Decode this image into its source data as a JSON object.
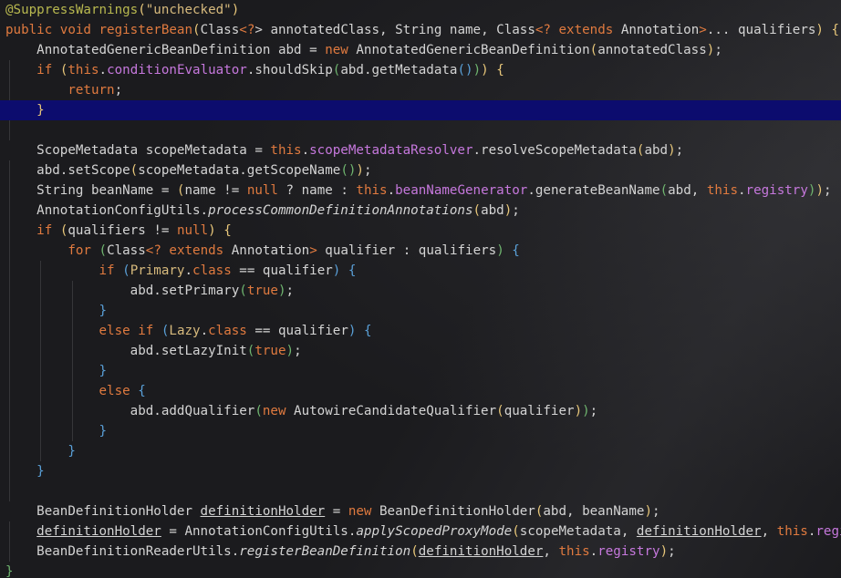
{
  "editor": {
    "language": "java",
    "highlighted_line": 6,
    "colors": {
      "background": "#1b1b1e",
      "line_highlight": "#0c0c6e",
      "keyword": "#e07a3f",
      "field": "#c678dd",
      "annotation": "#b8b84f",
      "string": "#d7ba7d",
      "text": "#d4d4d4"
    },
    "lines": [
      {
        "indent": 0,
        "tokens": [
          {
            "t": "@SuppressWarnings",
            "c": "ann"
          },
          {
            "t": "(",
            "c": "p1"
          },
          {
            "t": "\"unchecked\"",
            "c": "str"
          },
          {
            "t": ")",
            "c": "p1"
          }
        ]
      },
      {
        "indent": 0,
        "tokens": [
          {
            "t": "public",
            "c": "kw"
          },
          {
            "t": " "
          },
          {
            "t": "void",
            "c": "kw"
          },
          {
            "t": " "
          },
          {
            "t": "registerBean",
            "c": "kw"
          },
          {
            "t": "(",
            "c": "p1"
          },
          {
            "t": "Class"
          },
          {
            "t": "<?",
            "c": "kw"
          },
          {
            "t": "> annotatedClass, String name, Class"
          },
          {
            "t": "<?",
            "c": "kw"
          },
          {
            "t": " "
          },
          {
            "t": "extends",
            "c": "kw"
          },
          {
            "t": " Annotation"
          },
          {
            "t": ">",
            "c": "kw"
          },
          {
            "t": "... qualifiers"
          },
          {
            "t": ")",
            "c": "p1"
          },
          {
            "t": " "
          },
          {
            "t": "{",
            "c": "p1"
          }
        ]
      },
      {
        "indent": 1,
        "tokens": [
          {
            "t": "AnnotatedGenericBeanDefinition abd = "
          },
          {
            "t": "new",
            "c": "kw"
          },
          {
            "t": " AnnotatedGenericBeanDefinition"
          },
          {
            "t": "(",
            "c": "p1"
          },
          {
            "t": "annotatedClass"
          },
          {
            "t": ")",
            "c": "p1"
          },
          {
            "t": ";"
          }
        ]
      },
      {
        "indent": 1,
        "tokens": [
          {
            "t": "if",
            "c": "kw"
          },
          {
            "t": " "
          },
          {
            "t": "(",
            "c": "p1"
          },
          {
            "t": "this",
            "c": "kw"
          },
          {
            "t": "."
          },
          {
            "t": "conditionEvaluator",
            "c": "fld"
          },
          {
            "t": ".shouldSkip"
          },
          {
            "t": "(",
            "c": "p2"
          },
          {
            "t": "abd.getMetadata"
          },
          {
            "t": "()",
            "c": "p3"
          },
          {
            "t": ")",
            "c": "p2"
          },
          {
            "t": ")",
            "c": "p1"
          },
          {
            "t": " "
          },
          {
            "t": "{",
            "c": "p1"
          }
        ]
      },
      {
        "indent": 2,
        "tokens": [
          {
            "t": "return",
            "c": "kw"
          },
          {
            "t": ";"
          }
        ]
      },
      {
        "indent": 1,
        "tokens": [
          {
            "t": "}",
            "c": "p1"
          }
        ]
      },
      {
        "indent": 0,
        "tokens": []
      },
      {
        "indent": 1,
        "tokens": [
          {
            "t": "ScopeMetadata scopeMetadata = "
          },
          {
            "t": "this",
            "c": "kw"
          },
          {
            "t": "."
          },
          {
            "t": "scopeMetadataResolver",
            "c": "fld"
          },
          {
            "t": ".resolveScopeMetadata"
          },
          {
            "t": "(",
            "c": "p1"
          },
          {
            "t": "abd"
          },
          {
            "t": ")",
            "c": "p1"
          },
          {
            "t": ";"
          }
        ]
      },
      {
        "indent": 1,
        "tokens": [
          {
            "t": "abd.setScope"
          },
          {
            "t": "(",
            "c": "p1"
          },
          {
            "t": "scopeMetadata.getScopeName"
          },
          {
            "t": "()",
            "c": "p2"
          },
          {
            "t": ")",
            "c": "p1"
          },
          {
            "t": ";"
          }
        ]
      },
      {
        "indent": 1,
        "tokens": [
          {
            "t": "String beanName = "
          },
          {
            "t": "(",
            "c": "p1"
          },
          {
            "t": "name != "
          },
          {
            "t": "null",
            "c": "kw"
          },
          {
            "t": " ? name : "
          },
          {
            "t": "this",
            "c": "kw"
          },
          {
            "t": "."
          },
          {
            "t": "beanNameGenerator",
            "c": "fld"
          },
          {
            "t": ".generateBeanName"
          },
          {
            "t": "(",
            "c": "p2"
          },
          {
            "t": "abd, "
          },
          {
            "t": "this",
            "c": "kw"
          },
          {
            "t": "."
          },
          {
            "t": "registry",
            "c": "fld"
          },
          {
            "t": ")",
            "c": "p2"
          },
          {
            "t": ")",
            "c": "p1"
          },
          {
            "t": ";"
          }
        ]
      },
      {
        "indent": 1,
        "tokens": [
          {
            "t": "AnnotationConfigUtils."
          },
          {
            "t": "processCommonDefinitionAnnotations",
            "c": "it"
          },
          {
            "t": "(",
            "c": "p1"
          },
          {
            "t": "abd"
          },
          {
            "t": ")",
            "c": "p1"
          },
          {
            "t": ";"
          }
        ]
      },
      {
        "indent": 1,
        "tokens": [
          {
            "t": "if",
            "c": "kw"
          },
          {
            "t": " "
          },
          {
            "t": "(",
            "c": "p1"
          },
          {
            "t": "qualifiers != "
          },
          {
            "t": "null",
            "c": "kw"
          },
          {
            "t": ")",
            "c": "p1"
          },
          {
            "t": " "
          },
          {
            "t": "{",
            "c": "p1"
          }
        ]
      },
      {
        "indent": 2,
        "tokens": [
          {
            "t": "for",
            "c": "kw"
          },
          {
            "t": " "
          },
          {
            "t": "(",
            "c": "p2"
          },
          {
            "t": "Class"
          },
          {
            "t": "<?",
            "c": "kw"
          },
          {
            "t": " "
          },
          {
            "t": "extends",
            "c": "kw"
          },
          {
            "t": " Annotation"
          },
          {
            "t": ">",
            "c": "kw"
          },
          {
            "t": " qualifier : qualifiers"
          },
          {
            "t": ")",
            "c": "p2"
          },
          {
            "t": " "
          },
          {
            "t": "{",
            "c": "p3"
          }
        ]
      },
      {
        "indent": 3,
        "tokens": [
          {
            "t": "if",
            "c": "kw"
          },
          {
            "t": " "
          },
          {
            "t": "(",
            "c": "p3"
          },
          {
            "t": "Primary",
            "c": "cls"
          },
          {
            "t": "."
          },
          {
            "t": "class",
            "c": "kw"
          },
          {
            "t": " == qualifier"
          },
          {
            "t": ")",
            "c": "p3"
          },
          {
            "t": " "
          },
          {
            "t": "{",
            "c": "p3"
          }
        ]
      },
      {
        "indent": 4,
        "tokens": [
          {
            "t": "abd.setPrimary"
          },
          {
            "t": "(",
            "c": "p2"
          },
          {
            "t": "true",
            "c": "kw"
          },
          {
            "t": ")",
            "c": "p2"
          },
          {
            "t": ";"
          }
        ]
      },
      {
        "indent": 3,
        "tokens": [
          {
            "t": "}",
            "c": "p3"
          }
        ]
      },
      {
        "indent": 3,
        "tokens": [
          {
            "t": "else",
            "c": "kw"
          },
          {
            "t": " "
          },
          {
            "t": "if",
            "c": "kw"
          },
          {
            "t": " "
          },
          {
            "t": "(",
            "c": "p3"
          },
          {
            "t": "Lazy",
            "c": "cls"
          },
          {
            "t": "."
          },
          {
            "t": "class",
            "c": "kw"
          },
          {
            "t": " == qualifier"
          },
          {
            "t": ")",
            "c": "p3"
          },
          {
            "t": " "
          },
          {
            "t": "{",
            "c": "p3"
          }
        ]
      },
      {
        "indent": 4,
        "tokens": [
          {
            "t": "abd.setLazyInit"
          },
          {
            "t": "(",
            "c": "p2"
          },
          {
            "t": "true",
            "c": "kw"
          },
          {
            "t": ")",
            "c": "p2"
          },
          {
            "t": ";"
          }
        ]
      },
      {
        "indent": 3,
        "tokens": [
          {
            "t": "}",
            "c": "p3"
          }
        ]
      },
      {
        "indent": 3,
        "tokens": [
          {
            "t": "else",
            "c": "kw"
          },
          {
            "t": " "
          },
          {
            "t": "{",
            "c": "p3"
          }
        ]
      },
      {
        "indent": 4,
        "tokens": [
          {
            "t": "abd.addQualifier"
          },
          {
            "t": "(",
            "c": "p2"
          },
          {
            "t": "new",
            "c": "kw"
          },
          {
            "t": " AutowireCandidateQualifier"
          },
          {
            "t": "(",
            "c": "p1"
          },
          {
            "t": "qualifier"
          },
          {
            "t": ")",
            "c": "p1"
          },
          {
            "t": ")",
            "c": "p2"
          },
          {
            "t": ";"
          }
        ]
      },
      {
        "indent": 3,
        "tokens": [
          {
            "t": "}",
            "c": "p3"
          }
        ]
      },
      {
        "indent": 2,
        "tokens": [
          {
            "t": "}",
            "c": "p3"
          }
        ]
      },
      {
        "indent": 1,
        "tokens": [
          {
            "t": "}",
            "c": "p3"
          }
        ]
      },
      {
        "indent": 0,
        "tokens": []
      },
      {
        "indent": 1,
        "tokens": [
          {
            "t": "BeanDefinitionHolder "
          },
          {
            "t": "definitionHolder",
            "c": "ul"
          },
          {
            "t": " = "
          },
          {
            "t": "new",
            "c": "kw"
          },
          {
            "t": " BeanDefinitionHolder"
          },
          {
            "t": "(",
            "c": "p1"
          },
          {
            "t": "abd, beanName"
          },
          {
            "t": ")",
            "c": "p1"
          },
          {
            "t": ";"
          }
        ]
      },
      {
        "indent": 1,
        "tokens": [
          {
            "t": "definitionHolder",
            "c": "ul"
          },
          {
            "t": " = AnnotationConfigUtils."
          },
          {
            "t": "applyScopedProxyMode",
            "c": "it"
          },
          {
            "t": "(",
            "c": "p1"
          },
          {
            "t": "scopeMetadata, "
          },
          {
            "t": "definitionHolder",
            "c": "ul"
          },
          {
            "t": ", "
          },
          {
            "t": "this",
            "c": "kw"
          },
          {
            "t": "."
          },
          {
            "t": "registry",
            "c": "fld"
          },
          {
            "t": ")",
            "c": "p1"
          },
          {
            "t": ";"
          }
        ]
      },
      {
        "indent": 1,
        "tokens": [
          {
            "t": "BeanDefinitionReaderUtils."
          },
          {
            "t": "registerBeanDefinition",
            "c": "it"
          },
          {
            "t": "(",
            "c": "p1"
          },
          {
            "t": "definitionHolder",
            "c": "ul"
          },
          {
            "t": ", "
          },
          {
            "t": "this",
            "c": "kw"
          },
          {
            "t": "."
          },
          {
            "t": "registry",
            "c": "fld"
          },
          {
            "t": ")",
            "c": "p1"
          },
          {
            "t": ";"
          }
        ]
      },
      {
        "indent": 0,
        "tokens": [
          {
            "t": "}",
            "c": "p2"
          }
        ]
      }
    ]
  }
}
